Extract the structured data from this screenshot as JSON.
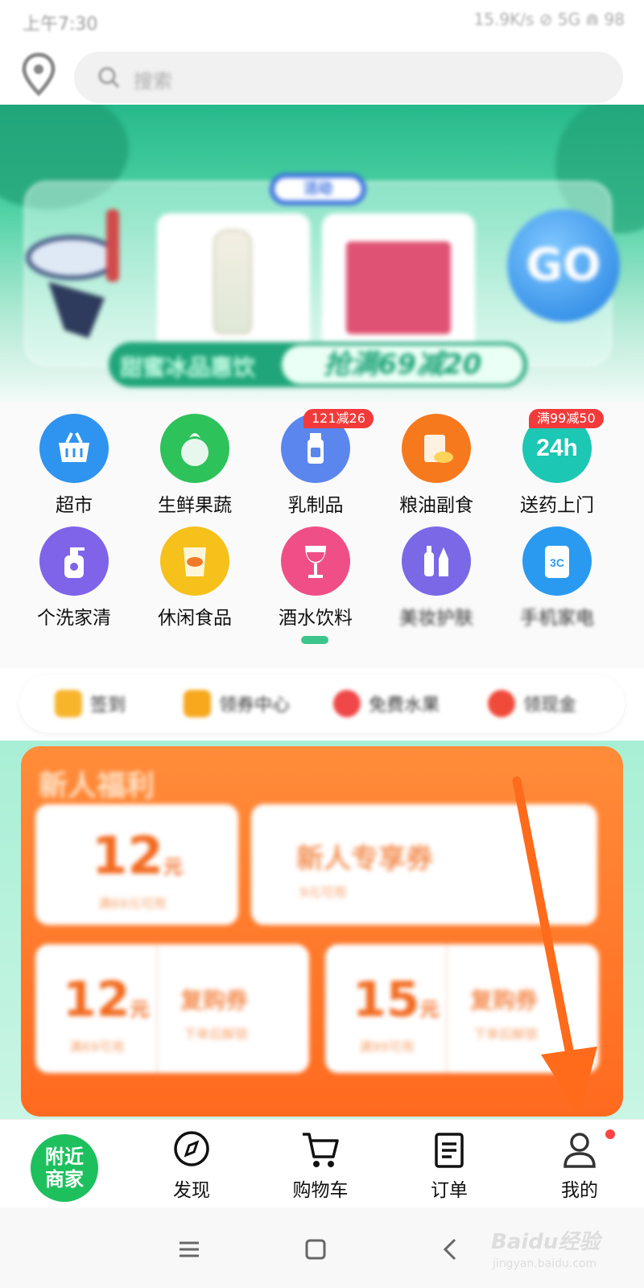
{
  "status_bar": {
    "time": "上午7:30",
    "indicators": "15.9K/s ⊘ 5G ⋒ 98"
  },
  "search": {
    "placeholder": "搜索"
  },
  "banner": {
    "tag": "活动",
    "slogan_left": "甜蜜冰品惠饮",
    "slogan_right": "抢满69减20",
    "go_text": "GO"
  },
  "categories": [
    {
      "label": "超市",
      "icon": "basket-icon",
      "color": "#2f93f0"
    },
    {
      "label": "生鲜果蔬",
      "icon": "vegetable-icon",
      "color": "#2ec25b"
    },
    {
      "label": "乳制品",
      "icon": "milk-icon",
      "color": "#5a86ee",
      "badge": "121减26"
    },
    {
      "label": "粮油副食",
      "icon": "grain-oil-icon",
      "color": "#f7791e"
    },
    {
      "label": "送药上门",
      "icon": "24h-medicine-icon",
      "color": "#1cc7b4",
      "icon_text": "24h",
      "badge": "满99减50"
    },
    {
      "label": "个洗家清",
      "icon": "soap-bottle-icon",
      "color": "#7f63e8"
    },
    {
      "label": "休闲食品",
      "icon": "snack-bag-icon",
      "color": "#f5c11a"
    },
    {
      "label": "酒水饮料",
      "icon": "wine-glass-icon",
      "color": "#ef4f86"
    },
    {
      "label": "美妆护肤",
      "icon": "cosmetics-icon",
      "color": "#7a68e6"
    },
    {
      "label": "手机家电",
      "icon": "3c-phone-icon",
      "color": "#2a9af0",
      "icon_text": "3C"
    }
  ],
  "quick_links": [
    {
      "label": "签到",
      "color": "#f7b52c"
    },
    {
      "label": "领券中心",
      "color": "#f7a81c"
    },
    {
      "label": "免费水果",
      "color": "#f04848"
    },
    {
      "label": "领现金",
      "color": "#f04a3a"
    }
  ],
  "welfare": {
    "title": "新人福利",
    "coupon_main": {
      "amount": "12",
      "unit": "元",
      "sub": "满69元可用"
    },
    "coupon_exclusive": {
      "name": "新人专享券",
      "sub": "9元可用"
    },
    "coupon_a": {
      "amount": "12",
      "unit": "元",
      "sub": "满69可用",
      "name": "复购券",
      "desc": "下单后解锁"
    },
    "coupon_b": {
      "amount": "15",
      "unit": "元",
      "sub": "满99可用",
      "name": "复购券",
      "desc": "下单后解锁"
    }
  },
  "tabbar": {
    "nearby_line1": "附近",
    "nearby_line2": "商家",
    "discover": "发现",
    "cart": "购物车",
    "orders": "订单",
    "mine": "我的"
  },
  "watermark": {
    "brand": "Baidu经验",
    "url": "jingyan.baidu.com"
  },
  "colors": {
    "accent_green": "#1ec05e",
    "welfare_orange": "#ff6a1f",
    "arrow_orange": "#ff6b1a"
  }
}
